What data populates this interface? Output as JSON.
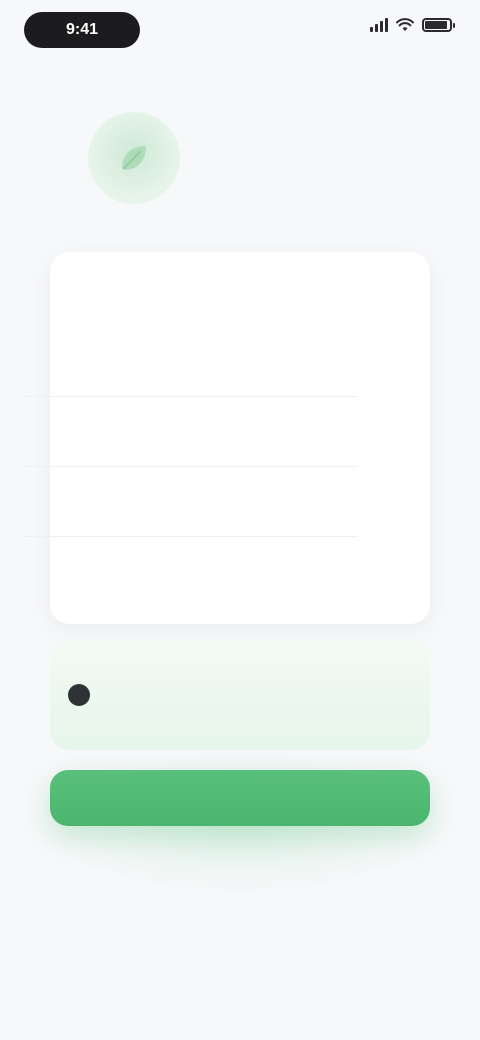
{
  "status_bar": {
    "time": "9:41",
    "icons": [
      "signal-icon",
      "wifi-icon",
      "battery-icon"
    ],
    "battery_level": 0.9
  },
  "header": {
    "logo_icon": "leaf-icon",
    "title": "",
    "subtitle": ""
  },
  "card": {
    "intro": "",
    "rows": [
      {
        "label": "",
        "value": ""
      },
      {
        "label": "",
        "value": ""
      },
      {
        "label": "",
        "value": ""
      },
      {
        "label": "",
        "value": ""
      }
    ]
  },
  "consent": {
    "checked": true,
    "text": ""
  },
  "actions": {
    "primary_label": "",
    "secondary_label": ""
  },
  "colors": {
    "accent": "#4bb56d",
    "accent_light": "#e6f5ea",
    "background": "#f7f8fa",
    "card": "#ffffff"
  }
}
